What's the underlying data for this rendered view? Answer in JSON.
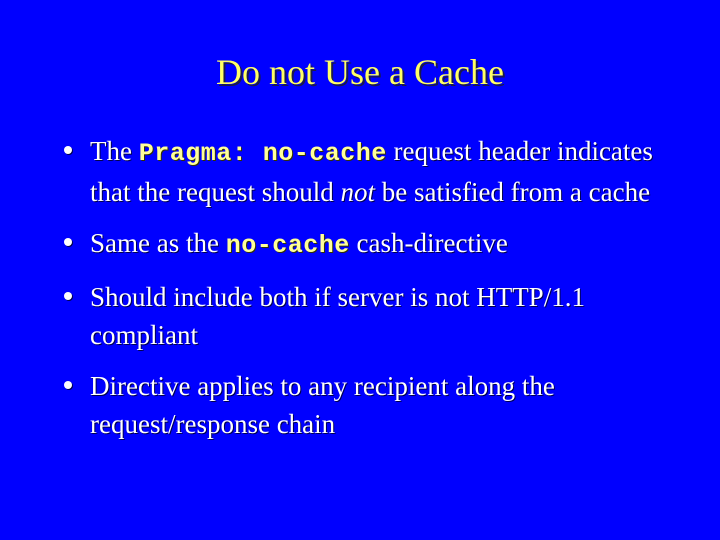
{
  "slide": {
    "background_color": "#0000ff",
    "title": "Do not Use a Cache",
    "title_color": "#ffff66",
    "body_color": "#ffffff",
    "code_color": "#ffff99",
    "bullets": [
      {
        "marker": "•",
        "parts": [
          {
            "text": "The ",
            "style": "normal"
          },
          {
            "text": "Pragma: no-cache",
            "style": "mono"
          },
          {
            "text": " request header indicates that the request should ",
            "style": "normal"
          },
          {
            "text": "not",
            "style": "italic"
          },
          {
            "text": " be satisfied from a cache",
            "style": "normal"
          }
        ],
        "plain": "The Pragma: no-cache request header indicates that the request should not be satisfied from a cache"
      },
      {
        "marker": "•",
        "parts": [
          {
            "text": "Same as the ",
            "style": "normal"
          },
          {
            "text": "no-cache",
            "style": "mono"
          },
          {
            "text": " cash-directive",
            "style": "normal"
          }
        ],
        "plain": "Same as the no-cache cash-directive"
      },
      {
        "marker": "•",
        "parts": [
          {
            "text": "Should include both if server is not HTTP/1.1 compliant",
            "style": "normal"
          }
        ],
        "plain": "Should include both if server is not HTTP/1.1 compliant"
      },
      {
        "marker": "•",
        "parts": [
          {
            "text": "Directive applies to any recipient along the request/response chain",
            "style": "normal"
          }
        ],
        "plain": "Directive applies to any recipient along the request/response chain"
      }
    ]
  }
}
